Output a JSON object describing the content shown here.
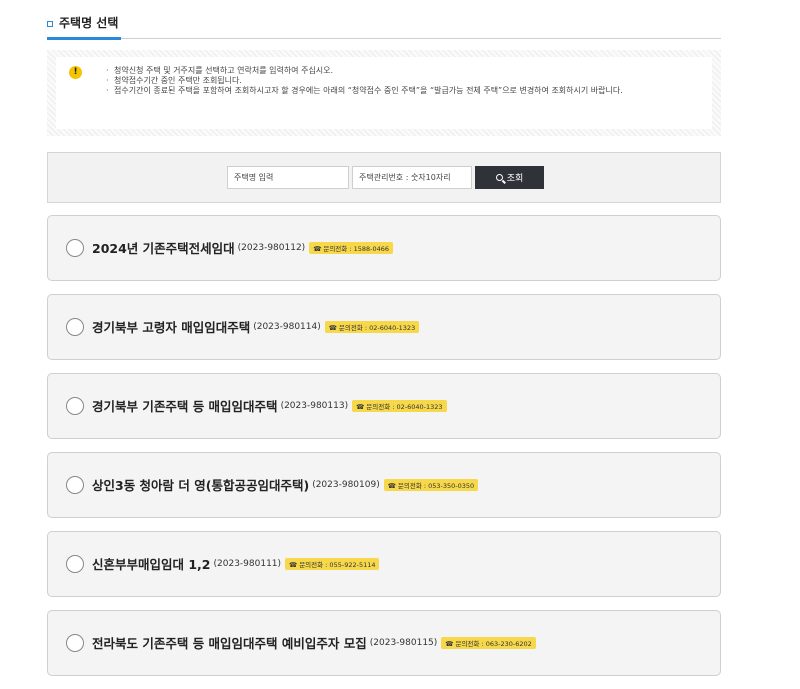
{
  "section": {
    "title": "주택명 선택"
  },
  "notice": {
    "icon": "exclamation-icon",
    "lines": [
      "청약신청 주택 및 거주지를 선택하고 연락처를 입력하여 주십시오.",
      "청약접수기간 중인 주택만 조회됩니다.",
      "접수기간이 종료된 주택을 포함하여 조회하시고자 할 경우에는 아래의 “청약접수 중인 주택”을 “발급가능 전체 주택”으로 변경하여 조회하시기 바랍니다."
    ]
  },
  "search": {
    "name_placeholder": "주택명 입력",
    "number_placeholder": "주택관리번호 : 숫자10자리",
    "button_label": "조회",
    "button_icon": "search-icon"
  },
  "houses": [
    {
      "name": "2024년 기존주택전세임대",
      "code": "(2023-980112)",
      "phone": "☎ 문의전화 : 1588-0466"
    },
    {
      "name": "경기북부 고령자 매입임대주택",
      "code": "(2023-980114)",
      "phone": "☎ 문의전화 : 02-6040-1323"
    },
    {
      "name": "경기북부 기존주택 등 매입임대주택",
      "code": "(2023-980113)",
      "phone": "☎ 문의전화 : 02-6040-1323"
    },
    {
      "name": "상인3동 청아람 더 영(통합공공임대주택)",
      "code": "(2023-980109)",
      "phone": "☎ 문의전화 : 053-350-0350"
    },
    {
      "name": "신혼부부매입임대 1,2",
      "code": "(2023-980111)",
      "phone": "☎ 문의전화 : 055-922-5114"
    },
    {
      "name": "전라북도 기존주택 등 매입임대주택 예비입주자 모집",
      "code": "(2023-980115)",
      "phone": "☎ 문의전화 : 063-230-6202"
    }
  ],
  "colors": {
    "accent": "#2b89d9",
    "phone_badge": "#f7d84a",
    "button": "#2f3238"
  }
}
